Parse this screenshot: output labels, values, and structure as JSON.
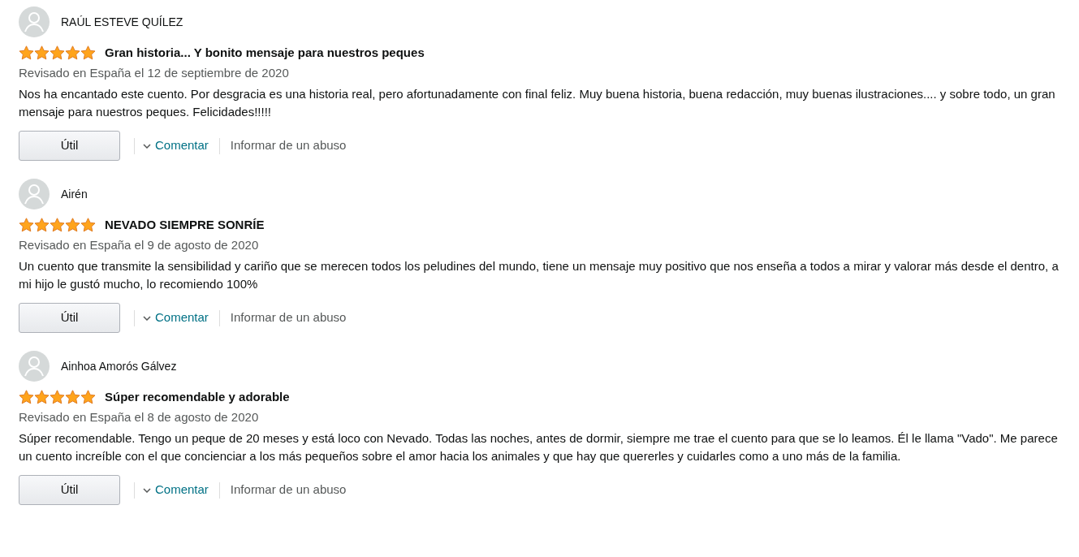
{
  "reviews": [
    {
      "author": "RAÚL ESTEVE QUÍLEZ",
      "stars": 5,
      "title": "Gran historia... Y bonito mensaje para nuestros peques",
      "date": "Revisado en España el 12 de septiembre de 2020",
      "body": "Nos ha encantado este cuento. Por desgracia es una historia real, pero afortunadamente con final feliz. Muy buena historia, buena redacción, muy buenas ilustraciones.... y sobre todo, un gran mensaje para nuestros peques. Felicidades!!!!!",
      "helpful": "Útil",
      "comment": "Comentar",
      "report": "Informar de un abuso"
    },
    {
      "author": "Airén",
      "stars": 5,
      "title": "NEVADO SIEMPRE SONRÍE",
      "date": "Revisado en España el 9 de agosto de 2020",
      "body": "Un cuento que transmite la sensibilidad y cariño que se merecen todos los peludines del mundo, tiene un mensaje muy positivo que nos enseña a todos a mirar y valorar más desde el dentro, a mi hijo le gustó mucho, lo recomiendo 100%",
      "helpful": "Útil",
      "comment": "Comentar",
      "report": "Informar de un abuso"
    },
    {
      "author": "Ainhoa Amorós Gálvez",
      "stars": 5,
      "title": "Súper recomendable y adorable",
      "date": "Revisado en España el 8 de agosto de 2020",
      "body": "Súper recomendable. Tengo un peque de 20 meses y está loco con Nevado. Todas las noches, antes de dormir, siempre me trae el cuento para que se lo leamos. Él le llama \"Vado\". Me parece un cuento increíble con el que concienciar a los más pequeños sobre el amor hacia los animales y que hay que quererles y cuidarles como a uno más de la familia.",
      "helpful": "Útil",
      "comment": "Comentar",
      "report": "Informar de un abuso"
    }
  ]
}
